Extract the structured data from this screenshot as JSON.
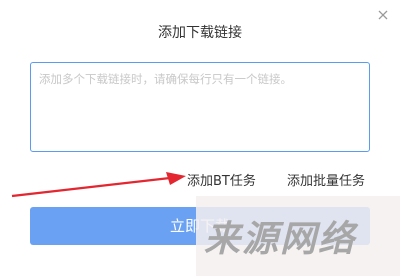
{
  "dialog": {
    "title": "添加下载链接",
    "close_icon": "close-icon"
  },
  "input": {
    "placeholder": "添加多个下载链接时，请确保每行只有一个链接。",
    "value": ""
  },
  "links": {
    "add_bt": "添加BT任务",
    "add_batch": "添加批量任务"
  },
  "submit": {
    "label": "立即下载"
  },
  "annotation": {
    "arrow_color": "#e3262f"
  },
  "watermark": {
    "text": "来源网络"
  },
  "colors": {
    "accent": "#6aa1f3",
    "input_border": "#5b9bf0"
  }
}
